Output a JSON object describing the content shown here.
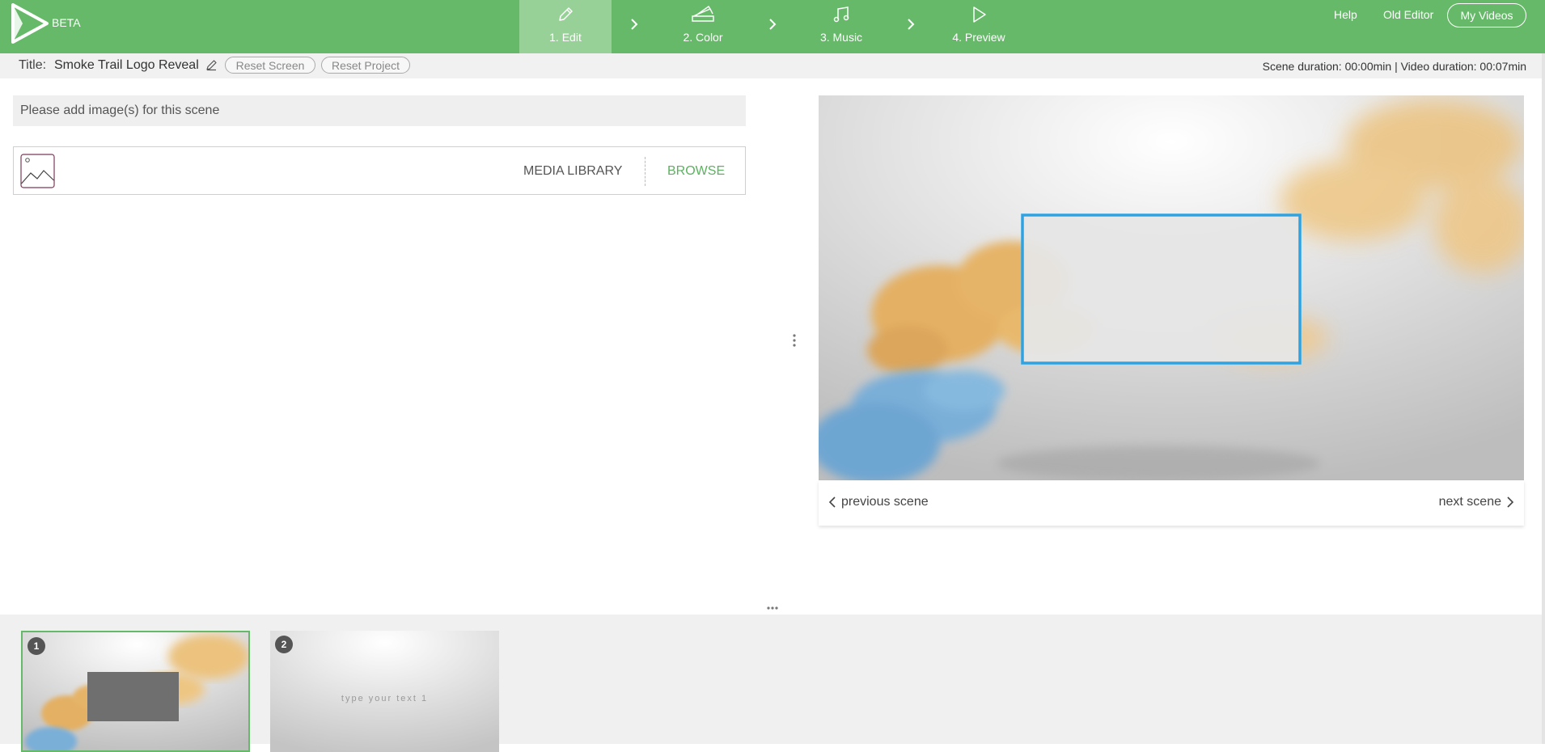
{
  "brand": {
    "badge": "BETA"
  },
  "steps": [
    {
      "label": "1. Edit",
      "icon": "pencil-icon",
      "active": true
    },
    {
      "label": "2. Color",
      "icon": "color-swatches-icon",
      "active": false
    },
    {
      "label": "3. Music",
      "icon": "music-note-icon",
      "active": false
    },
    {
      "label": "4. Preview",
      "icon": "play-icon",
      "active": false
    }
  ],
  "header_links": {
    "help": "Help",
    "old_editor": "Old Editor",
    "my_videos": "My Videos"
  },
  "project": {
    "title_label": "Title:",
    "title": "Smoke Trail Logo Reveal",
    "reset_screen": "Reset Screen",
    "reset_project": "Reset Project",
    "durations": "Scene duration: 00:00min | Video duration: 00:07min"
  },
  "editor": {
    "notice": "Please add image(s) for this scene",
    "media_library": "MEDIA LIBRARY",
    "browse": "BROWSE"
  },
  "preview": {
    "previous": "previous scene",
    "next": "next scene"
  },
  "scenes": [
    {
      "number": "1",
      "text": ""
    },
    {
      "number": "2",
      "text": "type your text 1"
    }
  ],
  "colors": {
    "brand_green": "#67b96a",
    "active_step": "#98d198",
    "frame_blue": "#2ea3e3",
    "smoke_orange": "#e8b567",
    "smoke_blue": "#6aa6d3"
  }
}
